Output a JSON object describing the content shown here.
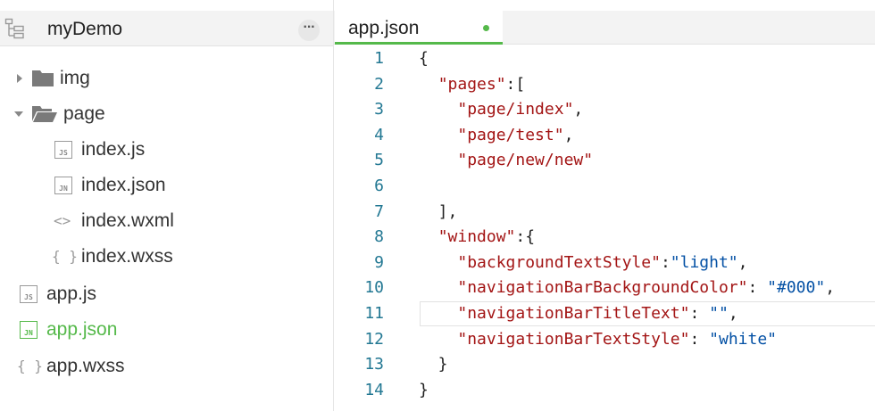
{
  "sidebar": {
    "project_name": "myDemo",
    "more_label": "···",
    "items": [
      {
        "label": "img",
        "type": "folder",
        "expanded": false,
        "depth": 0
      },
      {
        "label": "page",
        "type": "folder",
        "expanded": true,
        "depth": 0
      },
      {
        "label": "index.js",
        "type": "js",
        "badge": "JS",
        "depth": 1
      },
      {
        "label": "index.json",
        "type": "json",
        "badge": "JN",
        "depth": 1
      },
      {
        "label": "index.wxml",
        "type": "wxml",
        "badge": "<>",
        "depth": 1
      },
      {
        "label": "index.wxss",
        "type": "wxss",
        "badge": "{ }",
        "depth": 1
      },
      {
        "label": "app.js",
        "type": "js",
        "badge": "JS",
        "depth": 0
      },
      {
        "label": "app.json",
        "type": "json",
        "badge": "JN",
        "depth": 0,
        "active": true
      },
      {
        "label": "app.wxss",
        "type": "wxss",
        "badge": "{ }",
        "depth": 0
      }
    ]
  },
  "editor": {
    "tab_label": "app.json",
    "active_line": 11,
    "lines": [
      {
        "num": "1",
        "tokens": [
          [
            "p",
            "{"
          ]
        ]
      },
      {
        "num": "2",
        "tokens": [
          [
            "p",
            "  "
          ],
          [
            "k",
            "\"pages\""
          ],
          [
            "p",
            ":["
          ]
        ]
      },
      {
        "num": "3",
        "tokens": [
          [
            "p",
            "    "
          ],
          [
            "k",
            "\"page/index\""
          ],
          [
            "p",
            ","
          ]
        ]
      },
      {
        "num": "4",
        "tokens": [
          [
            "p",
            "    "
          ],
          [
            "k",
            "\"page/test\""
          ],
          [
            "p",
            ","
          ]
        ]
      },
      {
        "num": "5",
        "tokens": [
          [
            "p",
            "    "
          ],
          [
            "k",
            "\"page/new/new\""
          ]
        ]
      },
      {
        "num": "6",
        "tokens": []
      },
      {
        "num": "7",
        "tokens": [
          [
            "p",
            "  ],"
          ]
        ]
      },
      {
        "num": "8",
        "tokens": [
          [
            "p",
            "  "
          ],
          [
            "k",
            "\"window\""
          ],
          [
            "p",
            ":{"
          ]
        ]
      },
      {
        "num": "9",
        "tokens": [
          [
            "p",
            "    "
          ],
          [
            "k",
            "\"backgroundTextStyle\""
          ],
          [
            "p",
            ":"
          ],
          [
            "s",
            "\"light\""
          ],
          [
            "p",
            ","
          ]
        ]
      },
      {
        "num": "10",
        "tokens": [
          [
            "p",
            "    "
          ],
          [
            "k",
            "\"navigationBarBackgroundColor\""
          ],
          [
            "p",
            ": "
          ],
          [
            "s",
            "\"#000\""
          ],
          [
            "p",
            ","
          ]
        ]
      },
      {
        "num": "11",
        "tokens": [
          [
            "p",
            "    "
          ],
          [
            "k",
            "\"navigationBarTitleText\""
          ],
          [
            "p",
            ": "
          ],
          [
            "s",
            "\"\""
          ],
          [
            "p",
            ","
          ]
        ]
      },
      {
        "num": "12",
        "tokens": [
          [
            "p",
            "    "
          ],
          [
            "k",
            "\"navigationBarTextStyle\""
          ],
          [
            "p",
            ": "
          ],
          [
            "s",
            "\"white\""
          ]
        ]
      },
      {
        "num": "13",
        "tokens": [
          [
            "p",
            "  }"
          ]
        ]
      },
      {
        "num": "14",
        "tokens": [
          [
            "p",
            "}"
          ]
        ]
      }
    ]
  },
  "colors": {
    "accent": "#55b94a",
    "line_number": "#237893",
    "json_key": "#a31515",
    "json_string": "#0451a5"
  },
  "icons": {
    "tree_toggle": "tree-toggle-icon",
    "folder_closed": "folder-icon",
    "folder_open": "folder-open-icon",
    "more": "more-icon"
  }
}
